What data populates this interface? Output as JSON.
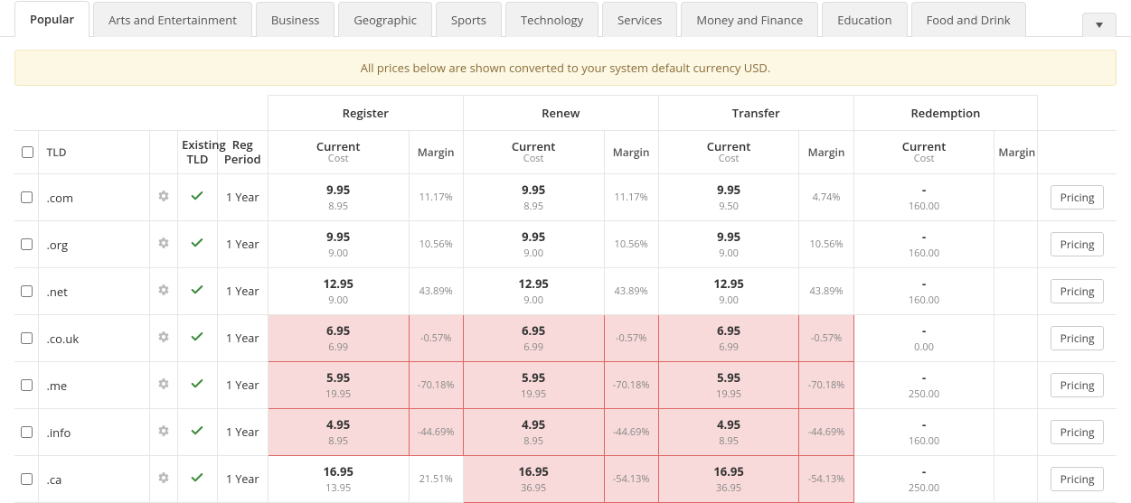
{
  "tabs": [
    "Popular",
    "Arts and Entertainment",
    "Business",
    "Geographic",
    "Sports",
    "Technology",
    "Services",
    "Money and Finance",
    "Education",
    "Food and Drink"
  ],
  "active_tab": 0,
  "caret_label": "▾",
  "notice": "All prices below are shown converted to your system default currency USD.",
  "headers": {
    "tld": "TLD",
    "existing": "Existing TLD",
    "period": "Reg Period",
    "groups": [
      "Register",
      "Renew",
      "Transfer",
      "Redemption"
    ],
    "current": "Current",
    "cost": "Cost",
    "margin": "Margin"
  },
  "action_label": "Pricing",
  "rows": [
    {
      "tld": ".com",
      "existing": true,
      "period": "1 Year",
      "register": {
        "current": "9.95",
        "cost": "8.95",
        "margin": "11.17%",
        "neg": false
      },
      "renew": {
        "current": "9.95",
        "cost": "8.95",
        "margin": "11.17%",
        "neg": false
      },
      "transfer": {
        "current": "9.95",
        "cost": "9.50",
        "margin": "4.74%",
        "neg": false
      },
      "redemption": {
        "current": "-",
        "cost": "160.00",
        "margin": "",
        "neg": false
      }
    },
    {
      "tld": ".org",
      "existing": true,
      "period": "1 Year",
      "register": {
        "current": "9.95",
        "cost": "9.00",
        "margin": "10.56%",
        "neg": false
      },
      "renew": {
        "current": "9.95",
        "cost": "9.00",
        "margin": "10.56%",
        "neg": false
      },
      "transfer": {
        "current": "9.95",
        "cost": "9.00",
        "margin": "10.56%",
        "neg": false
      },
      "redemption": {
        "current": "-",
        "cost": "160.00",
        "margin": "",
        "neg": false
      }
    },
    {
      "tld": ".net",
      "existing": true,
      "period": "1 Year",
      "register": {
        "current": "12.95",
        "cost": "9.00",
        "margin": "43.89%",
        "neg": false
      },
      "renew": {
        "current": "12.95",
        "cost": "9.00",
        "margin": "43.89%",
        "neg": false
      },
      "transfer": {
        "current": "12.95",
        "cost": "9.00",
        "margin": "43.89%",
        "neg": false
      },
      "redemption": {
        "current": "-",
        "cost": "160.00",
        "margin": "",
        "neg": false
      }
    },
    {
      "tld": ".co.uk",
      "existing": true,
      "period": "1 Year",
      "register": {
        "current": "6.95",
        "cost": "6.99",
        "margin": "-0.57%",
        "neg": true
      },
      "renew": {
        "current": "6.95",
        "cost": "6.99",
        "margin": "-0.57%",
        "neg": true
      },
      "transfer": {
        "current": "6.95",
        "cost": "6.99",
        "margin": "-0.57%",
        "neg": true
      },
      "redemption": {
        "current": "-",
        "cost": "0.00",
        "margin": "",
        "neg": false
      }
    },
    {
      "tld": ".me",
      "existing": true,
      "period": "1 Year",
      "register": {
        "current": "5.95",
        "cost": "19.95",
        "margin": "-70.18%",
        "neg": true
      },
      "renew": {
        "current": "5.95",
        "cost": "19.95",
        "margin": "-70.18%",
        "neg": true
      },
      "transfer": {
        "current": "5.95",
        "cost": "19.95",
        "margin": "-70.18%",
        "neg": true
      },
      "redemption": {
        "current": "-",
        "cost": "250.00",
        "margin": "",
        "neg": false
      }
    },
    {
      "tld": ".info",
      "existing": true,
      "period": "1 Year",
      "register": {
        "current": "4.95",
        "cost": "8.95",
        "margin": "-44.69%",
        "neg": true
      },
      "renew": {
        "current": "4.95",
        "cost": "8.95",
        "margin": "-44.69%",
        "neg": true
      },
      "transfer": {
        "current": "4.95",
        "cost": "8.95",
        "margin": "-44.69%",
        "neg": true
      },
      "redemption": {
        "current": "-",
        "cost": "160.00",
        "margin": "",
        "neg": false
      }
    },
    {
      "tld": ".ca",
      "existing": true,
      "period": "1 Year",
      "register": {
        "current": "16.95",
        "cost": "13.95",
        "margin": "21.51%",
        "neg": false
      },
      "renew": {
        "current": "16.95",
        "cost": "36.95",
        "margin": "-54.13%",
        "neg": true
      },
      "transfer": {
        "current": "16.95",
        "cost": "36.95",
        "margin": "-54.13%",
        "neg": true
      },
      "redemption": {
        "current": "-",
        "cost": "250.00",
        "margin": "",
        "neg": false
      }
    }
  ]
}
